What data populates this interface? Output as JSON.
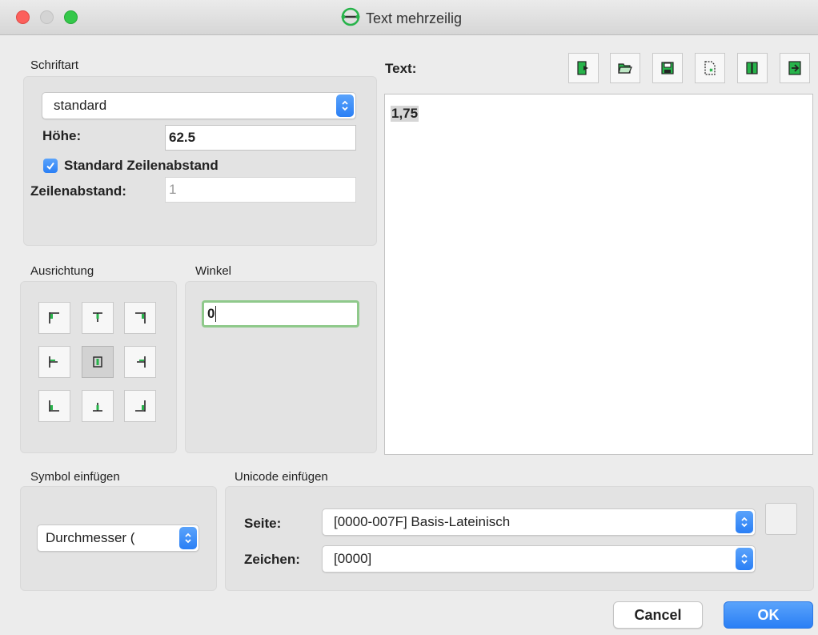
{
  "window": {
    "title": "Text mehrzeilig"
  },
  "schriftart": {
    "group_label": "Schriftart",
    "font_value": "standard",
    "height_label": "Höhe:",
    "height_value": "62.5",
    "standard_spacing_label": "Standard Zeilenabstand",
    "standard_spacing_checked": true,
    "line_spacing_label": "Zeilenabstand:",
    "line_spacing_value": "1"
  },
  "ausrichtung": {
    "group_label": "Ausrichtung",
    "selected": "middle-center",
    "buttons": [
      "top-left",
      "top-center",
      "top-right",
      "middle-left",
      "middle-center",
      "middle-right",
      "bottom-left",
      "bottom-center",
      "bottom-right"
    ]
  },
  "winkel": {
    "group_label": "Winkel",
    "value": "0"
  },
  "text": {
    "label": "Text:",
    "content": "1,75",
    "toolbar_icons": [
      "insert-file-icon",
      "open-folder-icon",
      "save-icon",
      "clear-icon",
      "book-icon",
      "insert-icon"
    ]
  },
  "symbol": {
    "group_label": "Symbol einfügen",
    "value": "Durchmesser ("
  },
  "unicode": {
    "group_label": "Unicode einfügen",
    "page_label": "Seite:",
    "page_value": "[0000-007F] Basis-Lateinisch",
    "char_label": "Zeichen:",
    "char_value": "[0000]"
  },
  "buttons": {
    "cancel": "Cancel",
    "ok": "OK"
  },
  "colors": {
    "accent": "#2a7ff5",
    "icon_green": "#27b34a",
    "focus": "#8fc98b"
  }
}
